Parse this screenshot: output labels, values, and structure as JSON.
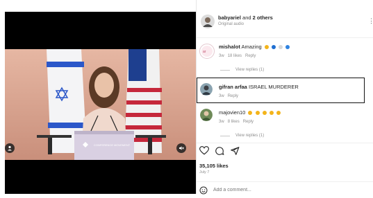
{
  "post_header": {
    "username": "babyariel",
    "joiner": "and",
    "others": "2 others",
    "audio": "Original audio"
  },
  "video": {
    "podium_sign": "CONFERENCE MOVEMENT"
  },
  "comments": [
    {
      "username": "mishalot",
      "text": "Amazing",
      "emojis": [
        "#f3b41b",
        "#1f6fd1",
        "#d8d8d8",
        "#2f83e0"
      ],
      "time": "3w",
      "likes": "18 likes",
      "reply_label": "Reply",
      "view_replies": "View replies (1)"
    },
    {
      "username": "gifran arfaa",
      "text": "ISRAEL MURDERER",
      "time": "3w",
      "reply_label": "Reply"
    },
    {
      "username": "majovien10",
      "emojis": [
        "#f3b41b",
        "#f3b41b",
        "#f3b41b",
        "#f3b41b",
        "#f3b41b"
      ],
      "time": "3w",
      "likes": "8 likes",
      "reply_label": "Reply",
      "view_replies": "View replies (1)"
    }
  ],
  "actions": {
    "likes_count": "35,105 likes",
    "date": "July 7"
  },
  "comment_input": {
    "placeholder": "Add a comment..."
  }
}
